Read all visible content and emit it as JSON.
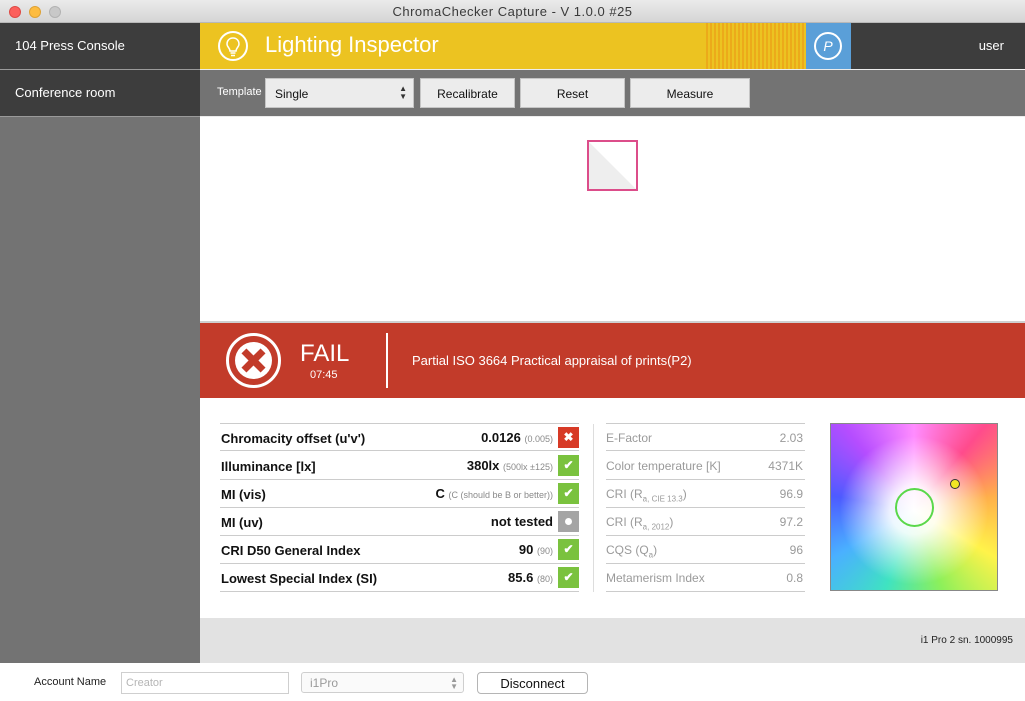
{
  "window": {
    "title": "ChromaChecker Capture  -  V 1.0.0 #25"
  },
  "sidebar": {
    "items": [
      {
        "label": "104 Press Console"
      },
      {
        "label": "Conference room"
      }
    ]
  },
  "header": {
    "title": "Lighting Inspector",
    "icon": "lightbulb-icon",
    "logo_text": "P",
    "user": "user",
    "colors": {
      "accent": "#ecc321",
      "logo_bg": "#5a9fd8",
      "dark": "#3d3d3d"
    }
  },
  "toolbar": {
    "template_label": "Template",
    "template_value": "Single",
    "recalibrate_label": "Recalibrate",
    "reset_label": "Reset",
    "measure_label": "Measure"
  },
  "banner": {
    "status": "FAIL",
    "time": "07:45",
    "description": "Partial ISO 3664 Practical appraisal of prints(P2)",
    "color": "#c23b2a"
  },
  "results": [
    {
      "label": "Chromacity offset (u'v')",
      "value": "0.0126",
      "limit": "(0.005)",
      "status": "fail"
    },
    {
      "label": "Illuminance [lx]",
      "value": "380lx",
      "limit": "(500lx ±125)",
      "status": "pass"
    },
    {
      "label": "MI (vis)",
      "value": "C",
      "limit": "(C (should be B or better))",
      "status": "pass"
    },
    {
      "label": "MI (uv)",
      "value": "not tested",
      "limit": "",
      "status": "not-tested"
    },
    {
      "label": "CRI D50 General Index",
      "value": "90",
      "limit": "(90)",
      "status": "pass"
    },
    {
      "label": "Lowest Special Index (SI)",
      "value": "85.6",
      "limit": "(80)",
      "status": "pass"
    }
  ],
  "metrics": [
    {
      "label": "E-Factor",
      "sub": "",
      "value": "2.03"
    },
    {
      "label": "Color temperature [K]",
      "sub": "",
      "value": "4371K"
    },
    {
      "label": "CRI (R",
      "sub": "a, CIE 13.3",
      "close": ")",
      "value": "96.9"
    },
    {
      "label": "CRI (R",
      "sub": "a, 2012",
      "close": ")",
      "value": "97.2"
    },
    {
      "label": "CQS (Q",
      "sub": "a",
      "close": ")",
      "value": "96"
    },
    {
      "label": "Metamerism Index",
      "sub": "",
      "value": "0.8"
    }
  ],
  "status_colors": {
    "fail": "#d73a26",
    "pass": "#7ac23e",
    "not_tested": "#a5a5a5"
  },
  "device": {
    "serial": "i1 Pro 2 sn. 1000995"
  },
  "footer": {
    "account_label": "Account Name",
    "account_placeholder": "Creator",
    "device_value": "i1Pro",
    "disconnect_label": "Disconnect"
  }
}
